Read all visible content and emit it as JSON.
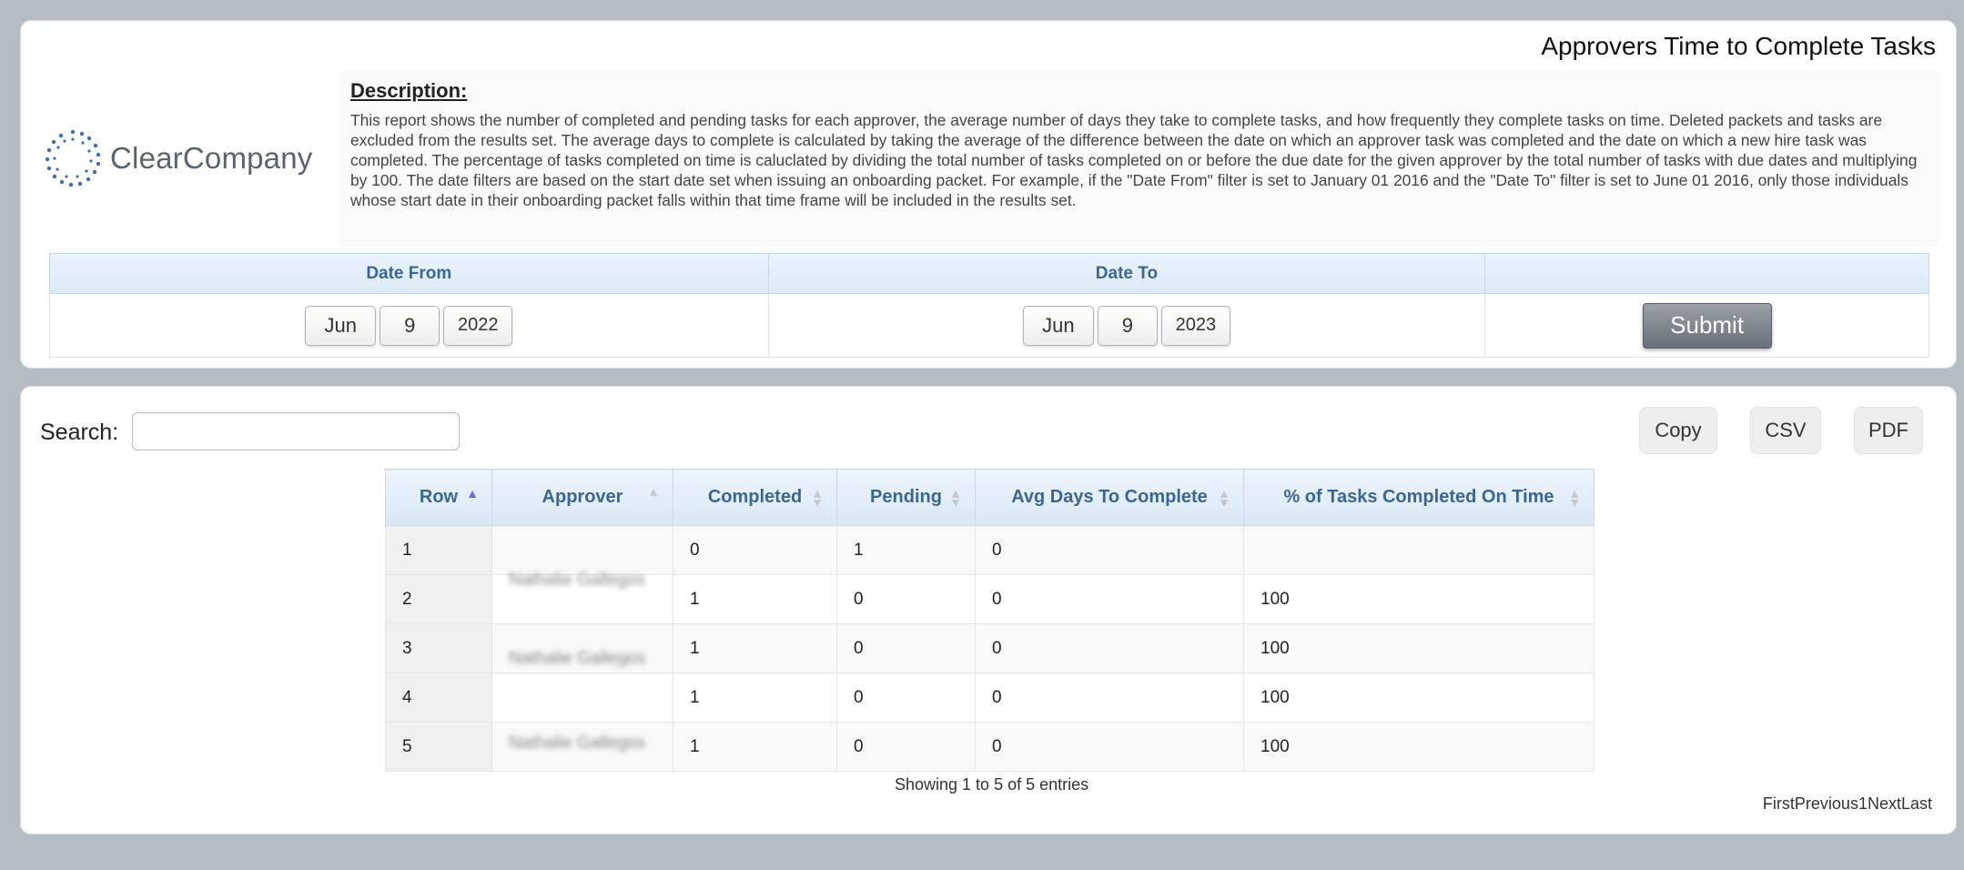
{
  "report": {
    "title": "Approvers Time to Complete Tasks",
    "logo_text": "ClearCompany",
    "description_heading": "Description:",
    "description": "This report shows the number of completed and pending tasks for each approver, the average number of days they take to complete tasks, and how frequently they complete tasks on time. Deleted packets and tasks are excluded from the results set. The average days to complete is calculated by taking the average of the difference between the date on which an approver task was completed and the date on which a new hire task was completed. The percentage of tasks completed on time is caluclated by dividing the total number of tasks completed on or before the due date for the given approver by the total number of tasks with due dates and multiplying by 100. The date filters are based on the start date set when issuing an onboarding packet. For example, if the \"Date From\" filter is set to January 01 2016 and the \"Date To\" filter is set to June 01 2016, only those individuals whose start date in their onboarding packet falls within that time frame will be included in the results set."
  },
  "filters": {
    "date_from_label": "Date From",
    "date_to_label": "Date To",
    "date_from": {
      "month": "Jun",
      "day": "9",
      "year": "2022"
    },
    "date_to": {
      "month": "Jun",
      "day": "9",
      "year": "2023"
    },
    "submit_label": "Submit"
  },
  "table_tools": {
    "search_label": "Search:",
    "search_value": "",
    "copy_label": "Copy",
    "csv_label": "CSV",
    "pdf_label": "PDF"
  },
  "table": {
    "columns": [
      "Row",
      "Approver",
      "Completed",
      "Pending",
      "Avg Days To Complete",
      "% of Tasks Completed On Time"
    ],
    "rows": [
      {
        "row": "1",
        "completed": "0",
        "pending": "1",
        "avg_days": "0",
        "pct_on_time": ""
      },
      {
        "row": "2",
        "completed": "1",
        "pending": "0",
        "avg_days": "0",
        "pct_on_time": "100"
      },
      {
        "row": "3",
        "completed": "1",
        "pending": "0",
        "avg_days": "0",
        "pct_on_time": "100"
      },
      {
        "row": "4",
        "completed": "1",
        "pending": "0",
        "avg_days": "0",
        "pct_on_time": "100"
      },
      {
        "row": "5",
        "completed": "1",
        "pending": "0",
        "avg_days": "0",
        "pct_on_time": "100"
      }
    ],
    "redacted_names": [
      "Nathalie Gallegos",
      "Nathalie Gallegos",
      "Nathalie Gallegos"
    ],
    "info": "Showing 1 to 5 of 5 entries",
    "pager": {
      "first": "First",
      "previous": "Previous",
      "page": "1",
      "next": "Next",
      "last": "Last"
    }
  }
}
